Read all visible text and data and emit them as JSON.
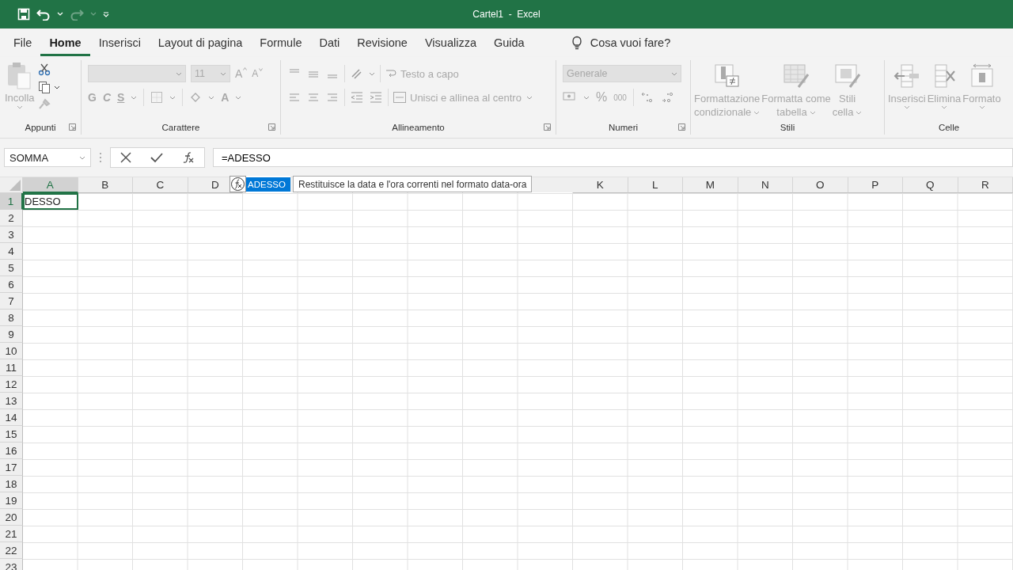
{
  "window": {
    "title": "Cartel1  -  Excel"
  },
  "quick_access": {
    "undo_enabled": true,
    "redo_enabled": false
  },
  "tabs": [
    {
      "label": "File",
      "selected": false
    },
    {
      "label": "Home",
      "selected": true
    },
    {
      "label": "Inserisci",
      "selected": false
    },
    {
      "label": "Layout di pagina",
      "selected": false
    },
    {
      "label": "Formule",
      "selected": false
    },
    {
      "label": "Dati",
      "selected": false
    },
    {
      "label": "Revisione",
      "selected": false
    },
    {
      "label": "Visualizza",
      "selected": false
    },
    {
      "label": "Guida",
      "selected": false
    }
  ],
  "tell_me": {
    "placeholder": "Cosa vuoi fare?"
  },
  "ribbon": {
    "disabled": true,
    "clipboard": {
      "label": "Appunti",
      "paste": "Incolla"
    },
    "font": {
      "label": "Carattere",
      "size": "11",
      "grow": "A",
      "shrink": "A",
      "bold": "G",
      "italic": "C",
      "underline": "S",
      "text_tint": "A"
    },
    "alignment": {
      "label": "Allineamento",
      "wrap": "Testo a capo",
      "merge": "Unisci e allinea al centro"
    },
    "number": {
      "label": "Numeri",
      "format": "Generale",
      "percent": "%",
      "thousands": "000"
    },
    "styles": {
      "label": "Stili",
      "buttons": [
        {
          "kind": "conditional",
          "lines": [
            "Formattazione",
            "condizionale"
          ]
        },
        {
          "kind": "table",
          "lines": [
            "Formatta come",
            "tabella"
          ]
        },
        {
          "kind": "cell",
          "lines": [
            "Stili",
            "cella"
          ]
        }
      ]
    },
    "cells": {
      "label": "Celle",
      "buttons": [
        {
          "kind": "insert",
          "label": "Inserisci"
        },
        {
          "kind": "delete",
          "label": "Elimina"
        },
        {
          "kind": "format",
          "label": "Formato"
        }
      ]
    }
  },
  "formula_bar": {
    "name_box": "SOMMA",
    "formula": "=ADESSO"
  },
  "sheet": {
    "columns": [
      {
        "label": "A",
        "selected": true
      },
      {
        "label": "B",
        "selected": false
      },
      {
        "label": "C",
        "selected": false
      },
      {
        "label": "D",
        "selected": false
      },
      {},
      {},
      {},
      {},
      {},
      {},
      {
        "label": "K",
        "selected": false
      },
      {
        "label": "L",
        "selected": false
      },
      {
        "label": "M",
        "selected": false
      },
      {
        "label": "N",
        "selected": false
      },
      {
        "label": "O",
        "selected": false
      },
      {
        "label": "P",
        "selected": false
      },
      {
        "label": "Q",
        "selected": false
      },
      {
        "label": "R",
        "selected": false
      }
    ],
    "rows": [
      {
        "label": "1",
        "selected": true,
        "cells": [
          {
            "value": "DESSO",
            "selected": true
          }
        ]
      },
      {
        "label": "2",
        "selected": false
      },
      {
        "label": "3",
        "selected": false
      },
      {
        "label": "4",
        "selected": false
      },
      {
        "label": "5",
        "selected": false
      },
      {
        "label": "6",
        "selected": false
      },
      {
        "label": "7",
        "selected": false
      },
      {
        "label": "8",
        "selected": false
      },
      {
        "label": "9",
        "selected": false
      },
      {
        "label": "10",
        "selected": false
      },
      {
        "label": "11",
        "selected": false
      },
      {
        "label": "12",
        "selected": false
      },
      {
        "label": "13",
        "selected": false
      },
      {
        "label": "14",
        "selected": false
      },
      {
        "label": "15",
        "selected": false
      },
      {
        "label": "16",
        "selected": false
      },
      {
        "label": "17",
        "selected": false
      },
      {
        "label": "18",
        "selected": false
      },
      {
        "label": "19",
        "selected": false
      },
      {
        "label": "20",
        "selected": false
      },
      {
        "label": "21",
        "selected": false
      },
      {
        "label": "22",
        "selected": false
      },
      {
        "label": "23",
        "selected": false
      }
    ]
  },
  "autocomplete": {
    "items": [
      {
        "label": "ADESSO",
        "selected": true
      }
    ],
    "tooltip": "Restituisce la data e l'ora correnti nel formato data-ora"
  }
}
